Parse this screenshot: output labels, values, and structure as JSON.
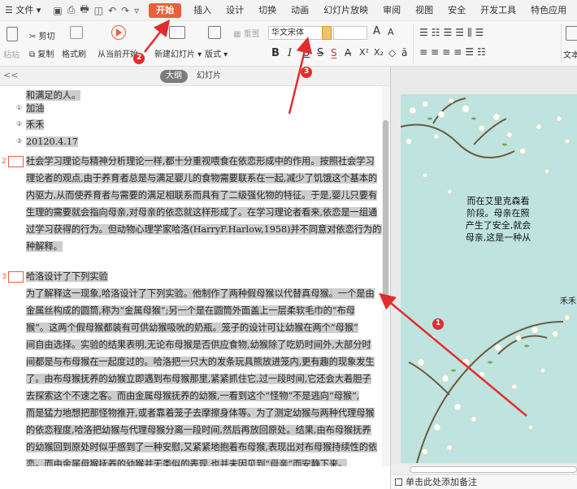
{
  "menu": {
    "file": "文件",
    "tabs": [
      "开始",
      "插入",
      "设计",
      "切换",
      "动画",
      "幻灯片放映",
      "审阅",
      "视图",
      "安全",
      "开发工具",
      "特色应用"
    ]
  },
  "ribbon": {
    "cut": "剪切",
    "paste": "粘贴",
    "copy": "复制",
    "format_painter": "格式刷",
    "from_current": "从当前开始",
    "new_slide": "新建幻灯片",
    "layout": "版式",
    "reset": "重置",
    "font_name": "华文宋体",
    "font_size": "",
    "grow": "A",
    "shrink": "A",
    "bold": "B",
    "italic": "I",
    "underline": "U",
    "strike": "S",
    "text_label": "文本"
  },
  "panel": {
    "collapse": "<<",
    "tab_outline": "大纲",
    "tab_slides": "幻灯片"
  },
  "outline": {
    "top_lines": [
      "和满足的人。",
      "加油",
      "禾禾",
      "20120.4.17"
    ],
    "sub_markers": [
      "①",
      "②",
      "③"
    ],
    "slide2_num": "2",
    "slide2_lines": [
      "社会学习理论与精神分析理论一样,都十分重视喂食在依恋形成中的作用。按照社会学习",
      "理论者的观点,由于养育者总是与满足婴儿的食物需要联系在一起,减少了饥饿这个基本的",
      "内驱力,从而使养育者与需要的满足相联系而具有了二级强化物的特征。于是,婴儿只要有",
      "生理的需要就会指向母亲,对母亲的依恋就这样形成了。在学习理论者看来,依恋是一组通",
      "过学习获得的行为。但动物心理学家哈洛(HarryF.Harlow,1958)并不同意对依恋行为的这",
      "种解释。"
    ],
    "slide3_num": "3",
    "slide3_title": "哈洛设计了下列实验",
    "slide3_lines": [
      "为了解释这一现象,哈洛设计了下列实验。他制作了两种假母猴以代替真母猴。一个是由",
      "金属丝构成的圆筒,称为“金属母猴”;另一个是在圆筒外面盖上一层柔软毛巾的“布母",
      "猴”。这两个假母猴都装有可供幼猴吸吮的奶瓶。笼子的设计可让幼猴在两个“母猴”",
      "间自由选择。实验的结果表明,无论布母猴是否供应食物,幼猴除了吃奶时间外,大部分时",
      "间都是与布母猴在一起度过的。哈洛把一只大的发条玩具熊放进笼内,更有趣的现象发生",
      "了。由布母猴抚养的幼猴立即遇到布母猴那里,紧紧抓住它,过一段时间,它还会大着胆子",
      "去探索这个不速之客。而由金属母猴抚养的幼猴,一看到这个“怪物”不是逃向“母猴”,",
      "而是猛力地想把那怪物推开,或者靠着笼子去摩擦身体等。为了测定幼猴与两种代理母猴",
      "的依恋程度,哈洛把幼猴与代理母猴分离一段时间,然后再放回原处。结果,由布母猴抚养",
      "的幼猴回到原处时似乎感到了一种安慰,又紧紧地抱着布母猴,表现出对布母猴持续性的依",
      "恋。而由金属母猴抚养的幼猴并无类似的表现,也并未因见到“母亲”而安静下来。"
    ]
  },
  "preview": {
    "slide_lines": [
      "而在艾里克森看",
      "阶段。母亲在照",
      "产生了安全,就会",
      "母亲,这是一种从"
    ],
    "signature": "禾禾",
    "notes_placeholder": "单击此处添加备注"
  },
  "annotations": [
    "1",
    "2",
    "3"
  ],
  "colors": {
    "accent": "#e8603c",
    "highlight": "#cdcdcd",
    "slide_bg": "#bfe3df",
    "annotation_red": "#e32c2c"
  }
}
